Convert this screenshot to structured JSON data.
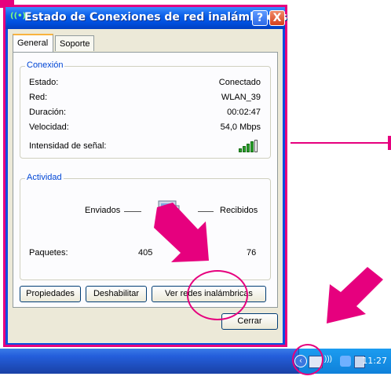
{
  "window": {
    "title": "Estado de Conexiones de red inalámbricas",
    "help_button": "?",
    "close_button": "X"
  },
  "tabs": [
    {
      "label": "General",
      "active": true
    },
    {
      "label": "Soporte",
      "active": false
    }
  ],
  "connection": {
    "group_title": "Conexión",
    "rows": [
      {
        "label": "Estado:",
        "value": "Conectado"
      },
      {
        "label": "Red:",
        "value": "WLAN_39"
      },
      {
        "label": "Duración:",
        "value": "00:02:47"
      },
      {
        "label": "Velocidad:",
        "value": "54,0 Mbps"
      }
    ],
    "signal_label": "Intensidad de señal:",
    "signal_bars": 5
  },
  "activity": {
    "group_title": "Actividad",
    "sent_label": "Enviados",
    "received_label": "Recibidos",
    "packets_label": "Paquetes:",
    "packets_sent": "405",
    "packets_received": "76"
  },
  "buttons": {
    "properties": "Propiedades",
    "disable": "Deshabilitar",
    "view_networks": "Ver redes inalámbricas",
    "close": "Cerrar"
  },
  "taskbar": {
    "clock": "11:27"
  },
  "colors": {
    "annotation": "#e6007e",
    "xp_blue": "#0a4de0",
    "group_title": "#0046d5"
  }
}
